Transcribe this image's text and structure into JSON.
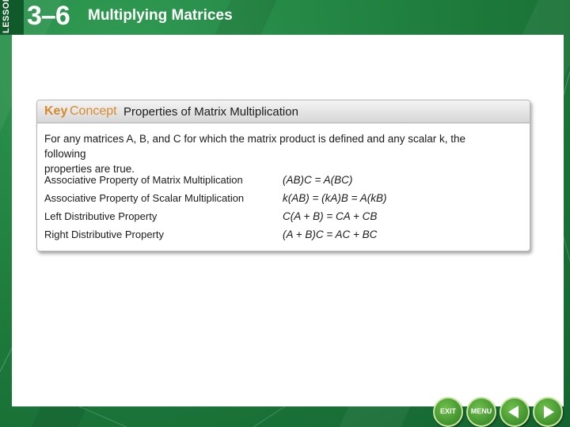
{
  "header": {
    "lesson_word": "LESSON",
    "lesson_number": "3–6",
    "lesson_title": "Multiplying Matrices"
  },
  "key_concept": {
    "label_part1": "Key",
    "label_part2": "Concept",
    "title": "Properties of Matrix Multiplication",
    "intro_line1": "For any matrices A, B, and C for which the matrix product is defined and any scalar k, the following",
    "intro_line2": "properties are true.",
    "properties": [
      {
        "name": "Associative Property of Matrix Multiplication",
        "formula": "(AB)C = A(BC)"
      },
      {
        "name": "Associative Property of Scalar Multiplication",
        "formula": "k(AB) = (kA)B = A(kB)"
      },
      {
        "name": "Left Distributive Property",
        "formula": "C(A + B) = CA + CB"
      },
      {
        "name": "Right Distributive Property",
        "formula": "(A + B)C = AC + BC"
      }
    ]
  },
  "nav": {
    "exit_label": "EXIT",
    "menu_label": "MENU"
  },
  "colors": {
    "frame_green": "#1f7a3e",
    "key_orange": "#d8892a",
    "button_green": "#2c7d21"
  },
  "icons": {
    "prev": "arrow-left-icon",
    "next": "arrow-right-icon"
  }
}
